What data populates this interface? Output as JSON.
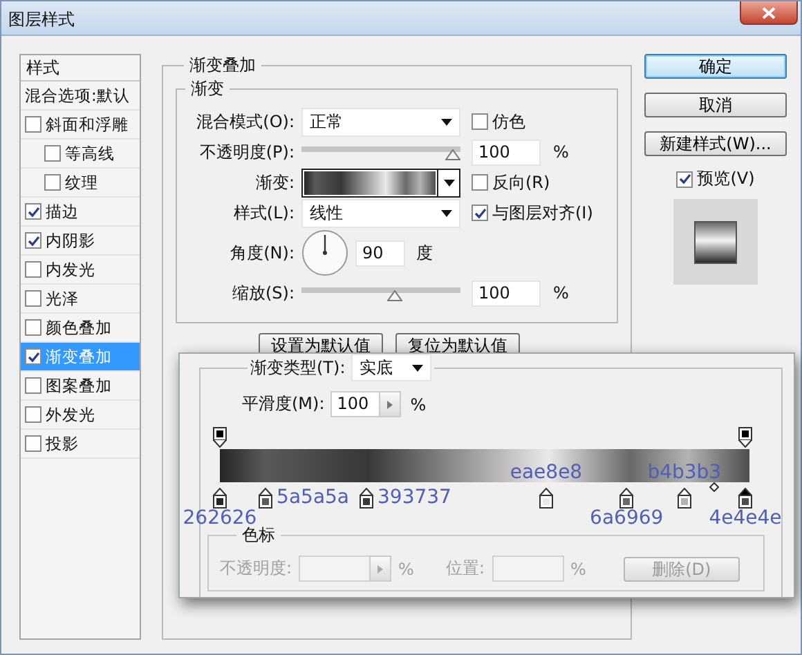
{
  "window": {
    "title": "图层样式"
  },
  "sidebar": {
    "header": "样式",
    "items": [
      {
        "label": "混合选项:默认",
        "kind": "plain",
        "selected": false
      },
      {
        "label": "斜面和浮雕",
        "kind": "check",
        "checked": false,
        "selected": false,
        "children": [
          {
            "label": "等高线",
            "kind": "check",
            "checked": false,
            "selected": false
          },
          {
            "label": "纹理",
            "kind": "check",
            "checked": false,
            "selected": false
          }
        ]
      },
      {
        "label": "描边",
        "kind": "check",
        "checked": true,
        "selected": false
      },
      {
        "label": "内阴影",
        "kind": "check",
        "checked": true,
        "selected": false
      },
      {
        "label": "内发光",
        "kind": "check",
        "checked": false,
        "selected": false
      },
      {
        "label": "光泽",
        "kind": "check",
        "checked": false,
        "selected": false
      },
      {
        "label": "颜色叠加",
        "kind": "check",
        "checked": false,
        "selected": false
      },
      {
        "label": "渐变叠加",
        "kind": "check",
        "checked": true,
        "selected": true
      },
      {
        "label": "图案叠加",
        "kind": "check",
        "checked": false,
        "selected": false
      },
      {
        "label": "外发光",
        "kind": "check",
        "checked": false,
        "selected": false
      },
      {
        "label": "投影",
        "kind": "check",
        "checked": false,
        "selected": false
      }
    ]
  },
  "panel": {
    "title": "渐变叠加",
    "group": {
      "title": "渐变",
      "rows": [
        {
          "kind": "select",
          "label": "混合模式(O):",
          "value": "正常",
          "option": {
            "label": "仿色",
            "checked": false
          }
        },
        {
          "kind": "slider",
          "label": "不透明度(P):",
          "level": 1,
          "value": "100",
          "unit": "%"
        },
        {
          "kind": "gradient",
          "label": "渐变:",
          "option": {
            "label": "反向(R)",
            "checked": false
          }
        },
        {
          "kind": "select",
          "label": "样式(L):",
          "value": "线性",
          "option": {
            "label": "与图层对齐(I)",
            "checked": true
          }
        },
        {
          "kind": "angle",
          "label": "角度(N):",
          "value": "90",
          "unit": "度"
        },
        {
          "kind": "slider",
          "label": "缩放(S):",
          "level": 0.6,
          "value": "100",
          "unit": "%"
        }
      ]
    },
    "buttons": [
      "设置为默认值",
      "复位为默认值"
    ]
  },
  "actions": {
    "buttons": [
      {
        "label": "确定",
        "focused": true
      },
      {
        "label": "取消",
        "focused": false
      },
      {
        "label": "新建样式(W)...",
        "focused": false
      }
    ],
    "preview": {
      "label": "预览(V)",
      "checked": true
    }
  },
  "editor": {
    "type_label": "渐变类型(T):",
    "type_value": "实底",
    "smoothness_label": "平滑度(M):",
    "smoothness_value": "100",
    "smoothness_unit": "%",
    "opacity_stops": [
      {
        "level": 0
      },
      {
        "level": 1
      }
    ],
    "color_stops": [
      {
        "level": 0,
        "color": "#262626",
        "selected": false,
        "annotation": {
          "text": "262626",
          "kind": "below"
        }
      },
      {
        "level": 0.087,
        "color": "#5a5a5a",
        "selected": false,
        "annotation": {
          "text": "5a5a5a",
          "kind": "right"
        }
      },
      {
        "level": 0.279,
        "color": "#393737",
        "selected": false,
        "annotation": {
          "text": "393737",
          "kind": "right"
        }
      },
      {
        "level": 0.621,
        "color": "#eae8e8",
        "selected": false,
        "annotation": {
          "text": "eae8e8",
          "kind": "above"
        }
      },
      {
        "level": 0.774,
        "color": "#6a6969",
        "selected": false,
        "annotation": {
          "text": "6a6969",
          "kind": "below"
        }
      },
      {
        "level": 0.884,
        "color": "#b4b3b3",
        "selected": false,
        "annotation": {
          "text": "b4b3b3",
          "kind": "above"
        }
      },
      {
        "level": 1,
        "color": "#4e4e4e",
        "selected": true,
        "annotation": {
          "text": "4e4e4e",
          "kind": "below"
        }
      }
    ],
    "stop_section": {
      "title": "色标",
      "disabled": true,
      "opacity_label": "不透明度:",
      "opacity_unit": "%",
      "position_label": "位置:",
      "position_unit": "%",
      "delete_button": "删除(D)"
    }
  }
}
